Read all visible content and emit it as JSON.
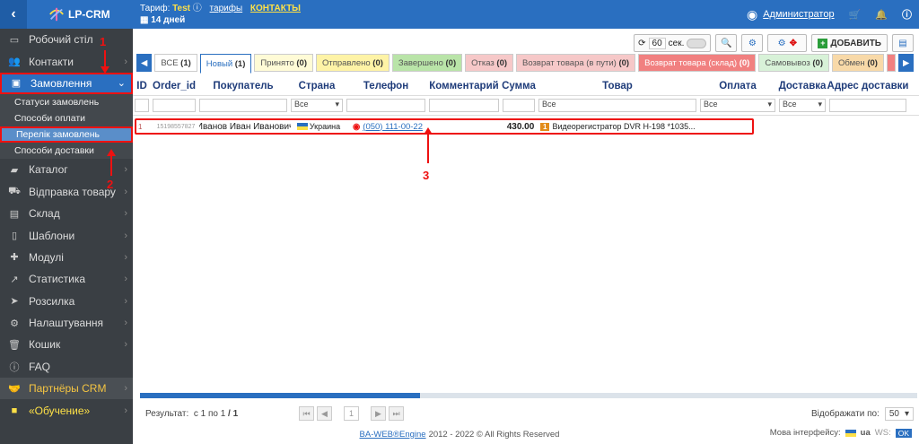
{
  "header": {
    "logo": "LP-CRM",
    "tariff_label": "Тариф:",
    "tariff_value": "Test",
    "tariffs_link": "тарифы",
    "contacts_link": "КОНТАКТЫ",
    "days": "14 дней",
    "user": "Администратор"
  },
  "sidebar": {
    "items": [
      {
        "label": "Робочий стіл",
        "icon": "monitor-icon"
      },
      {
        "label": "Контакти",
        "icon": "users-icon"
      },
      {
        "label": "Замовлення",
        "icon": "money-icon"
      },
      {
        "label": "Каталог",
        "icon": "folder-icon"
      },
      {
        "label": "Відправка товару",
        "icon": "truck-icon"
      },
      {
        "label": "Склад",
        "icon": "box-icon"
      },
      {
        "label": "Шаблони",
        "icon": "file-icon"
      },
      {
        "label": "Модулі",
        "icon": "puzzle-icon"
      },
      {
        "label": "Статистика",
        "icon": "chart-icon"
      },
      {
        "label": "Розсилка",
        "icon": "send-icon"
      },
      {
        "label": "Налаштування",
        "icon": "gear-icon"
      },
      {
        "label": "Кошик",
        "icon": "trash-icon"
      },
      {
        "label": "FAQ",
        "icon": "info-icon"
      },
      {
        "label": "Партнёры CRM",
        "icon": "handshake-icon"
      },
      {
        "label": "«Обучение»",
        "icon": "video-icon"
      }
    ],
    "subitems": [
      "Статуси замовлень",
      "Способи оплати",
      "Перелік замовлень",
      "Способи доставки"
    ]
  },
  "toolbar": {
    "refresh_value": "60",
    "refresh_unit": "сек.",
    "add_label": "ДОБАВИТЬ"
  },
  "tabs": [
    {
      "label": "ВСЕ",
      "count": "(1)",
      "bg": "#ffffff",
      "color": "#333"
    },
    {
      "label": "Новый",
      "count": "(1)",
      "bg": "#ffffff",
      "color": "#2a6fc0"
    },
    {
      "label": "Принято",
      "count": "(0)",
      "bg": "#fffbd6",
      "color": "#777"
    },
    {
      "label": "Отправлено",
      "count": "(0)",
      "bg": "#fef3a6",
      "color": "#555"
    },
    {
      "label": "Завершено",
      "count": "(0)",
      "bg": "#b9e4a8",
      "color": "#555"
    },
    {
      "label": "Отказ",
      "count": "(0)",
      "bg": "#f6c8c8",
      "color": "#555"
    },
    {
      "label": "Возврат товара (в пути)",
      "count": "(0)",
      "bg": "#f6c8c8",
      "color": "#555"
    },
    {
      "label": "Возврат товара (склад)",
      "count": "(0)",
      "bg": "#f18080",
      "color": "#fff"
    },
    {
      "label": "Самовывоз",
      "count": "(0)",
      "bg": "#d8f2d8",
      "color": "#555"
    },
    {
      "label": "Обмен",
      "count": "(0)",
      "bg": "#f8d9a8",
      "color": "#555"
    }
  ],
  "columns": [
    "ID",
    "Order_id",
    "Покупатель",
    "Страна",
    "Телефон",
    "Комментарий",
    "Сумма",
    "Товар",
    "Оплата",
    "Доставка",
    "Адрес доставки"
  ],
  "filter_all": "Все",
  "order_row": {
    "id": "1",
    "order_id": "15198557827",
    "customer": "Иванов Иван Иванович",
    "country": "Украина",
    "phone": "(050) 111-00-22",
    "sum": "430.00",
    "qty": "1",
    "product": "Видеорегистратор DVR H-198 *1035..."
  },
  "footer": {
    "result_label": "Результат:",
    "result_value": "с 1 по 1",
    "result_total": "/ 1",
    "page": "1",
    "show_label": "Відображати по:",
    "show_value": "50",
    "copyright_link": "BA-WEB®Engine",
    "copyright_text": "2012 - 2022 © All Rights Reserved",
    "lang_label": "Мова інтерфейсу:",
    "lang_value": "ua",
    "ws_label": "WS:",
    "ws_value": "OK"
  },
  "annotations": [
    "1",
    "2",
    "3"
  ],
  "colors": {
    "accent": "#2a6fc0",
    "highlight": "#e11111",
    "sidebar": "#3a3f44"
  }
}
